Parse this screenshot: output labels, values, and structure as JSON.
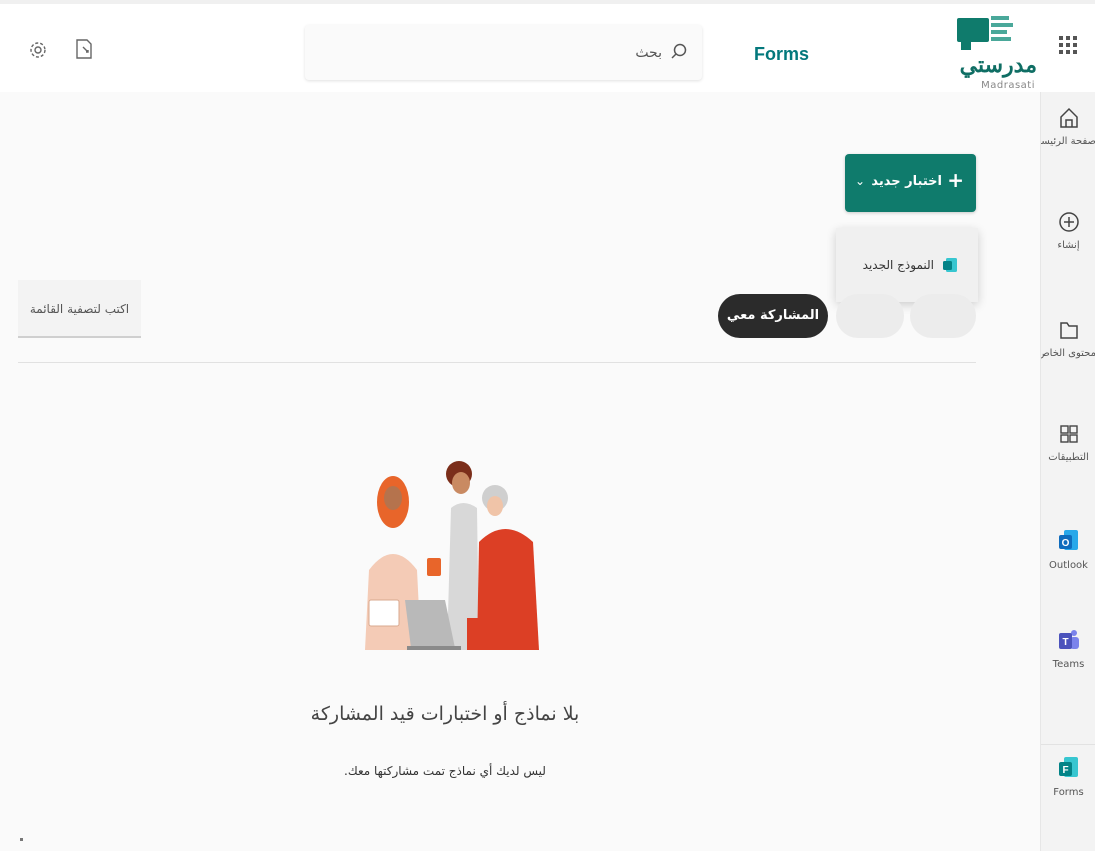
{
  "header": {
    "brand": "مدرستي",
    "brand_sub": "Madrasati",
    "app_name": "Forms",
    "search_placeholder": "بحث"
  },
  "rail": {
    "items": [
      {
        "label": "صفحة الرئيسية",
        "icon": "home-icon"
      },
      {
        "label": "إنشاء",
        "icon": "create-icon"
      },
      {
        "label": "محتوى الخاص",
        "icon": "folder-icon"
      },
      {
        "label": "التطبيقات",
        "icon": "apps-icon"
      },
      {
        "label": "Outlook",
        "icon": "outlook-icon"
      },
      {
        "label": "Teams",
        "icon": "teams-icon"
      },
      {
        "label": "Forms",
        "icon": "forms-icon"
      }
    ]
  },
  "toolbar": {
    "new_quiz_label": "اختبار جديد",
    "menu_new_form": "النموذج الجديد",
    "filter_shared": "المشاركة معي",
    "filter_label": "اكتب لتصفية القائمة"
  },
  "empty_state": {
    "title": "بلا نماذج أو اختبارات قيد المشاركة",
    "subtitle": "ليس لديك أي نماذج تمت مشاركتها معك."
  },
  "colors": {
    "accent": "#0f7b6c",
    "brand": "#03787c",
    "pill_active": "#2b2b2b"
  }
}
